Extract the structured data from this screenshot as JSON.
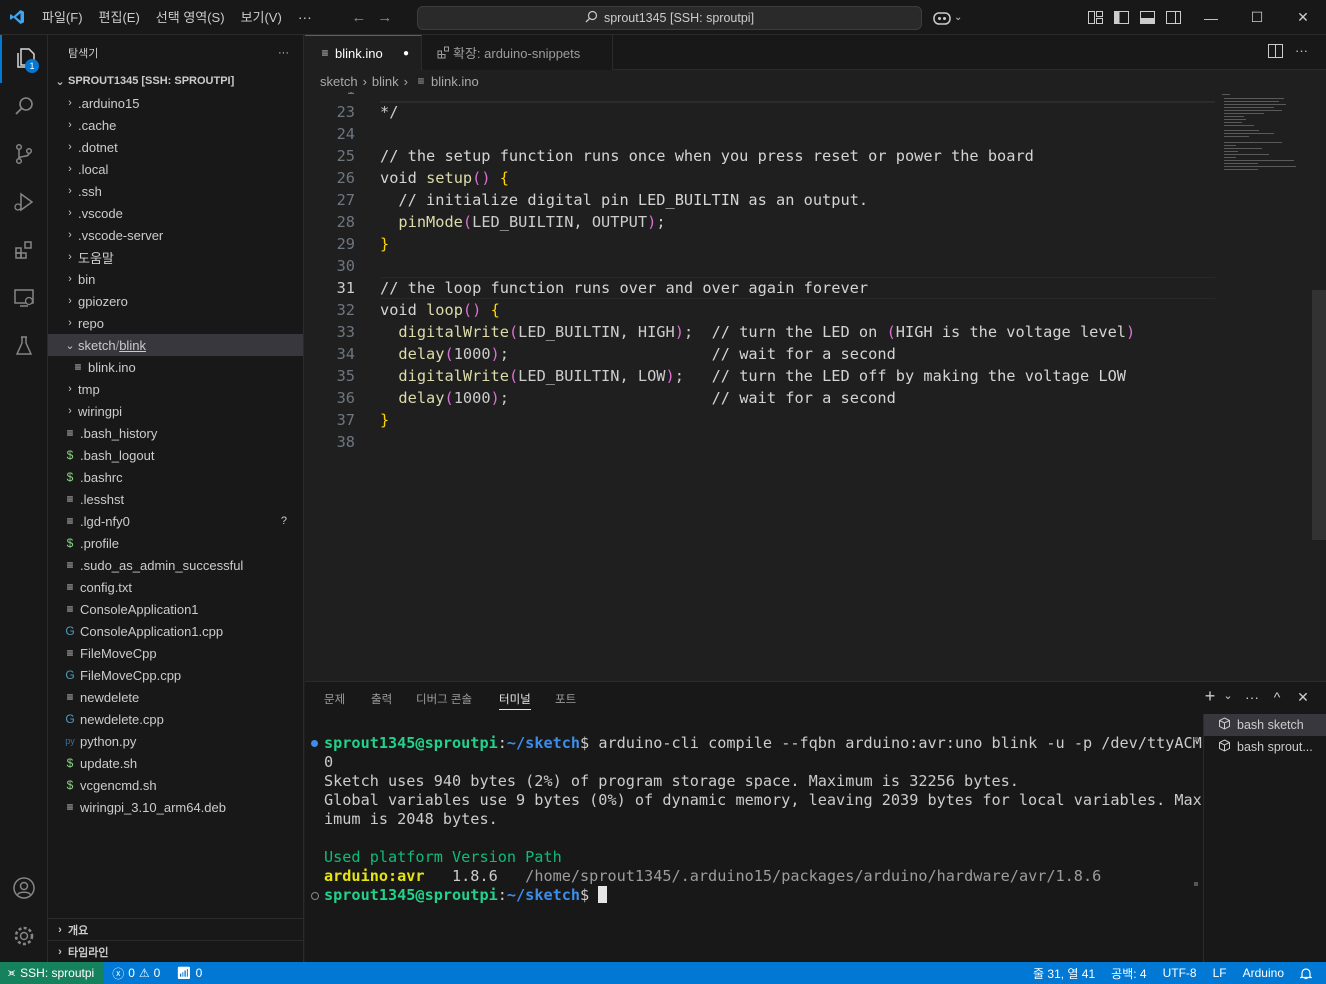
{
  "titlebar": {
    "menus": [
      "파일(F)",
      "편집(E)",
      "선택 영역(S)",
      "보기(V)"
    ],
    "more": "···",
    "search_text": "sprout1345 [SSH: sproutpi]",
    "win_minimize": "—",
    "win_maximize": "☐",
    "win_close": "✕"
  },
  "activity": {
    "explorer_badge": "1"
  },
  "sidebar": {
    "title": "탐색기",
    "more": "···",
    "root": "SPROUT1345 [SSH: SPROUTPI]",
    "items": [
      {
        "label": ".arduino15",
        "chev": "›",
        "icon": ""
      },
      {
        "label": ".cache",
        "chev": "›",
        "icon": ""
      },
      {
        "label": ".dotnet",
        "chev": "›",
        "icon": ""
      },
      {
        "label": ".local",
        "chev": "›",
        "icon": ""
      },
      {
        "label": ".ssh",
        "chev": "›",
        "icon": ""
      },
      {
        "label": ".vscode",
        "chev": "›",
        "icon": ""
      },
      {
        "label": ".vscode-server",
        "chev": "›",
        "icon": ""
      },
      {
        "label": "도움말",
        "chev": "›",
        "icon": ""
      },
      {
        "label": "bin",
        "chev": "›",
        "icon": ""
      },
      {
        "label": "gpiozero",
        "chev": "›",
        "icon": ""
      },
      {
        "label": "repo",
        "chev": "›",
        "icon": ""
      },
      {
        "label": "sketch",
        "label2": "blink",
        "chev": "⌄",
        "icon": ""
      },
      {
        "label": "blink.ino",
        "chev": "",
        "icon": "≡"
      },
      {
        "label": "tmp",
        "chev": "›",
        "icon": ""
      },
      {
        "label": "wiringpi",
        "chev": "›",
        "icon": ""
      },
      {
        "label": ".bash_history",
        "chev": "",
        "icon": "≡"
      },
      {
        "label": ".bash_logout",
        "chev": "",
        "icon": "$"
      },
      {
        "label": ".bashrc",
        "chev": "",
        "icon": "$"
      },
      {
        "label": ".lesshst",
        "chev": "",
        "icon": "≡"
      },
      {
        "label": ".lgd-nfy0",
        "chev": "",
        "icon": "≡"
      },
      {
        "label": ".profile",
        "chev": "",
        "icon": "$"
      },
      {
        "label": ".sudo_as_admin_successful",
        "chev": "",
        "icon": "≡"
      },
      {
        "label": "config.txt",
        "chev": "",
        "icon": "≡"
      },
      {
        "label": "ConsoleApplication1",
        "chev": "",
        "icon": "≡"
      },
      {
        "label": "ConsoleApplication1.cpp",
        "chev": "",
        "icon": "G"
      },
      {
        "label": "FileMoveCpp",
        "chev": "",
        "icon": "≡"
      },
      {
        "label": "FileMoveCpp.cpp",
        "chev": "",
        "icon": "G"
      },
      {
        "label": "newdelete",
        "chev": "",
        "icon": "≡"
      },
      {
        "label": "newdelete.cpp",
        "chev": "",
        "icon": "G"
      },
      {
        "label": "python.py",
        "chev": "",
        "icon": "py"
      },
      {
        "label": "update.sh",
        "chev": "",
        "icon": "$"
      },
      {
        "label": "vcgencmd.sh",
        "chev": "",
        "icon": "$"
      },
      {
        "label": "wiringpi_3.10_arm64.deb",
        "chev": "",
        "icon": "≡"
      }
    ],
    "git_untracked": "?",
    "outline": "개요",
    "timeline": "타임라인"
  },
  "tabs": {
    "active_label": "blink.ino",
    "dirty_dot": "●",
    "inactive_label": "확장: arduino-snippets"
  },
  "breadcrumb": [
    "sketch",
    "blink",
    "blink.ino"
  ],
  "editor": {
    "partial_line": "1",
    "lines": [
      {
        "n": "23",
        "text": "*/"
      },
      {
        "n": "24",
        "text": ""
      },
      {
        "n": "25",
        "text": "// the setup function runs once when you press reset or power the board"
      },
      {
        "n": "26",
        "text": "void setup() {"
      },
      {
        "n": "27",
        "text": "  // initialize digital pin LED_BUILTIN as an output."
      },
      {
        "n": "28",
        "text": "  pinMode(LED_BUILTIN, OUTPUT);"
      },
      {
        "n": "29",
        "text": "}"
      },
      {
        "n": "30",
        "text": ""
      },
      {
        "n": "31",
        "text": "// the loop function runs over and over again forever"
      },
      {
        "n": "32",
        "text": "void loop() {"
      },
      {
        "n": "33",
        "text": "  digitalWrite(LED_BUILTIN, HIGH);  // turn the LED on (HIGH is the voltage level)"
      },
      {
        "n": "34",
        "text": "  delay(1000);                      // wait for a second"
      },
      {
        "n": "35",
        "text": "  digitalWrite(LED_BUILTIN, LOW);   // turn the LED off by making the voltage LOW"
      },
      {
        "n": "36",
        "text": "  delay(1000);                      // wait for a second"
      },
      {
        "n": "37",
        "text": "}"
      },
      {
        "n": "38",
        "text": ""
      }
    ]
  },
  "panel": {
    "tabs": [
      "문제",
      "출력",
      "디버그 콘솔",
      "터미널",
      "포트"
    ],
    "active_tab": "터미널",
    "ctl_add": "+",
    "ctl_chev": "⌄",
    "ctl_more": "···",
    "ctl_max": "^",
    "ctl_close": "✕",
    "terminal": {
      "prompt_user": "sprout1345@sproutpi",
      "prompt_colon": ":",
      "prompt_path": "~/sketch",
      "prompt_dollar": "$",
      "command": " arduino-cli compile --fqbn arduino:avr:uno blink -u -p /dev/ttyACM",
      "wrap": "0",
      "out1": "Sketch uses 940 bytes (2%) of program storage space. Maximum is 32256 bytes.",
      "out2": "Global variables use 9 bytes (0%) of dynamic memory, leaving 2039 bytes for local variables. Max",
      "out3": "imum is 2048 bytes.",
      "table_head": "Used platform Version Path",
      "table_platform": "arduino:avr",
      "table_version": "   1.8.6",
      "table_path": "   /home/sprout1345/.arduino15/packages/arduino/hardware/avr/1.8.6"
    },
    "terminals": [
      "bash sketch",
      "bash sprout..."
    ]
  },
  "statusbar": {
    "remote": "SSH: sproutpi",
    "errors": "0",
    "warnings": "0",
    "ports": "0",
    "position": "줄 31, 열 41",
    "indent": "공백: 4",
    "encoding": "UTF-8",
    "eol": "LF",
    "language": "Arduino"
  },
  "colors": {
    "accent": "#0078d4",
    "remote": "#16825d",
    "terminal_green": "#23d18b",
    "terminal_blue": "#3b8eea",
    "terminal_yellow": "#e5e510"
  }
}
